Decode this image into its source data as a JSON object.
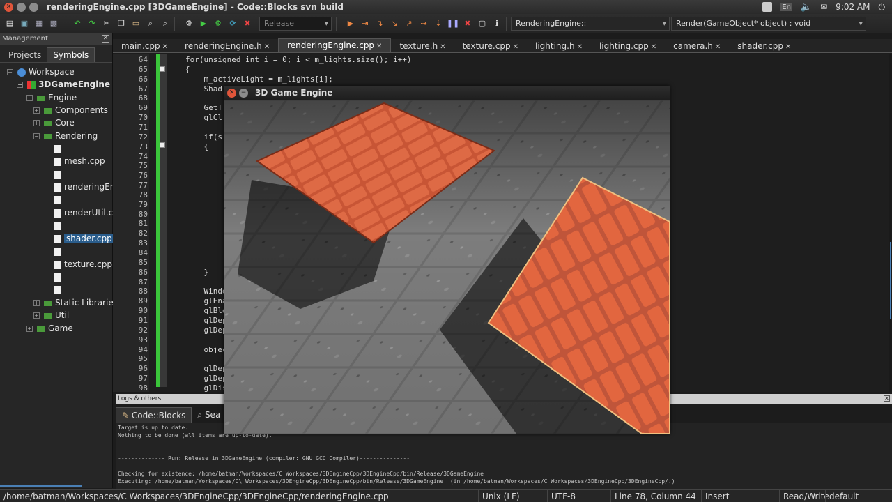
{
  "titlebar": {
    "title": "renderingEngine.cpp [3DGameEngine] - Code::Blocks svn build",
    "time": "9:02 AM",
    "keyboard": "En"
  },
  "toolbar": {
    "build_target": "Release",
    "scope": "RenderingEngine::",
    "function": "Render(GameObject* object) : void"
  },
  "management": {
    "title": "Management",
    "tabs": [
      "Projects",
      "Symbols"
    ],
    "tree": {
      "workspace": "Workspace",
      "project": "3DGameEngine",
      "engine": "Engine",
      "components": "Components",
      "core": "Core",
      "rendering": "Rendering",
      "files": [
        "mesh.cpp",
        "renderingEng",
        "renderUtil.cp",
        "shader.cpp",
        "texture.cpp"
      ],
      "static_libraries": "Static Libraries",
      "util": "Util",
      "game": "Game"
    }
  },
  "editor_tabs": [
    "main.cpp",
    "renderingEngine.h",
    "renderingEngine.cpp",
    "texture.h",
    "texture.cpp",
    "lighting.h",
    "lighting.cpp",
    "camera.h",
    "shader.cpp"
  ],
  "editor": {
    "line_numbers": [
      "64",
      "65",
      "66",
      "67",
      "68",
      "69",
      "70",
      "71",
      "72",
      "73",
      "74",
      "75",
      "76",
      "77",
      "78",
      "79",
      "80",
      "81",
      "82",
      "83",
      "84",
      "85",
      "86",
      "87",
      "88",
      "89",
      "90",
      "91",
      "92",
      "93",
      "94",
      "95",
      "96",
      "97",
      "98"
    ],
    "lines": [
      "for(unsigned int i = 0; i < m_lights.size(); i++)",
      "{",
      "    m_activeLight = m_lights[i];",
      "    Shad",
      "",
      "    GetT",
      "    glCl",
      "",
      "    if(s",
      "    {",
      "        ",
      "        ",
      "        ",
      "",
      "        ",
      "",
      "        ",
      "        ",
      "",
      "        ",
      "",
      "        ",
      "    }",
      "",
      "    Windo",
      "    glEna",
      "    glBle",
      "    glDep",
      "    glDep",
      "",
      "    objec",
      "",
      "    glDep",
      "    glDep",
      "    glDis"
    ]
  },
  "game_window": {
    "title": "3D Game Engine"
  },
  "logs": {
    "header": "Logs & others",
    "tabs": [
      "Code::Blocks",
      "Sea"
    ],
    "lines": [
      "Target is up to date.",
      "Nothing to be done (all items are up-to-date).",
      "",
      "",
      "-------------- Run: Release in 3DGameEngine (compiler: GNU GCC Compiler)---------------",
      "",
      "Checking for existence: /home/batman/Workspaces/C Workspaces/3DEngineCpp/3DEngineCpp/bin/Release/3DGameEngine",
      "Executing: /home/batman/Workspaces/C\\ Workspaces/3DEngineCpp/3DEngineCpp/bin/Release/3DGameEngine  (in /home/batman/Workspaces/C Workspaces/3DEngineCpp/3DEngineCpp/.)"
    ]
  },
  "statusbar": {
    "path": "/home/batman/Workspaces/C Workspaces/3DEngineCpp/3DEngineCpp/renderingEngine.cpp",
    "eol": "Unix (LF)",
    "encoding": "UTF-8",
    "position": "Line 78, Column 44",
    "mode": "Insert",
    "access": "Read/Write",
    "lexer": "default"
  }
}
